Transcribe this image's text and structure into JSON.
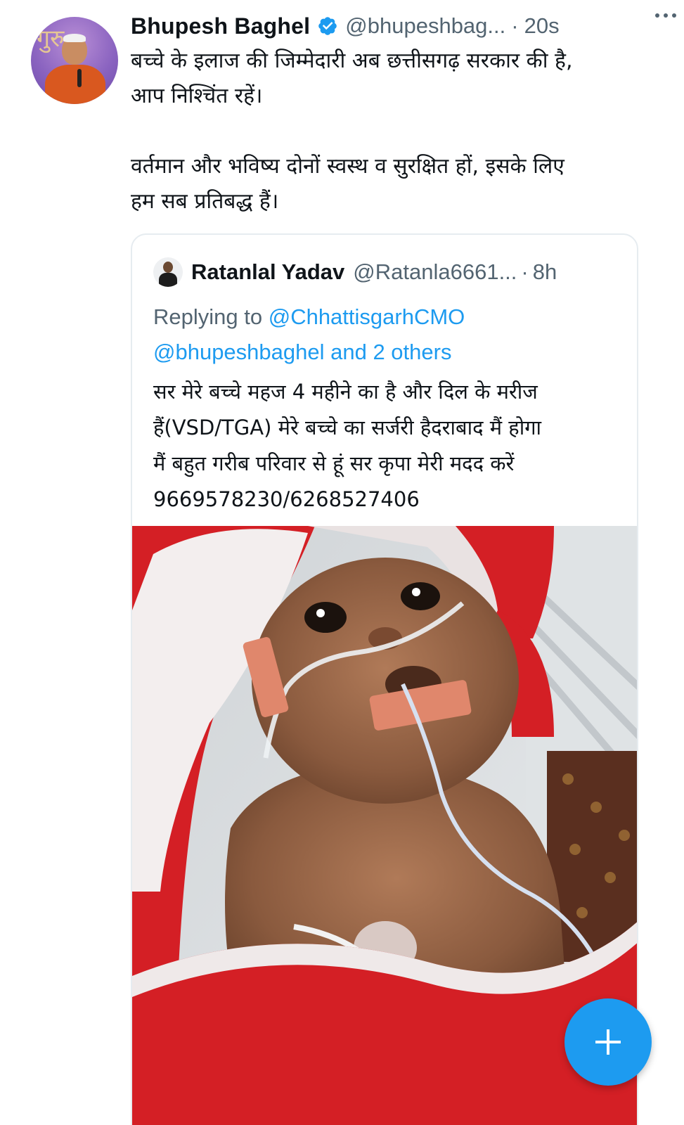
{
  "tweet": {
    "author": {
      "display_name": "Bhupesh Baghel",
      "handle": "@bhupeshbag...",
      "verified": true,
      "avatar_text": "गुरु"
    },
    "separator": "·",
    "time": "20s",
    "more_icon": "more-horizontal-icon",
    "text_lines": [
      "बच्चे के इलाज की जिम्मेदारी अब छत्तीसगढ़ सरकार की है,",
      "आप निश्चिंत रहें।",
      "वर्तमान और भविष्य दोनों स्वस्थ व सुरक्षित हों, इसके लिए",
      "हम सब प्रतिबद्ध हैं।"
    ]
  },
  "quoted_tweet": {
    "author": {
      "display_name": "Ratanlal Yadav",
      "handle": "@Ratanla6661..."
    },
    "separator": "·",
    "time": "8h",
    "replying_prefix": "Replying to",
    "replying_mention_1": "@ChhattisgarhCMO",
    "replying_mention_2": "@bhupeshbaghel and 2 others",
    "text_lines": [
      "सर मेरे बच्चे महज 4 महीने का है और दिल के मरीज",
      "हैं(VSD/TGA) मेरे बच्चे का सर्जरी हैदराबाद मैं होगा",
      "मैं बहुत गरीब परिवार से हूं सर कृपा मेरी मदद करें",
      "9669578230/6268527406"
    ],
    "photo_icon": "infant-photo"
  },
  "fab": {
    "icon": "plus-icon"
  },
  "colors": {
    "accent": "#1d9bf0",
    "secondary_text": "#536471",
    "primary_text": "#0f1419",
    "border": "#e6ecf0"
  }
}
